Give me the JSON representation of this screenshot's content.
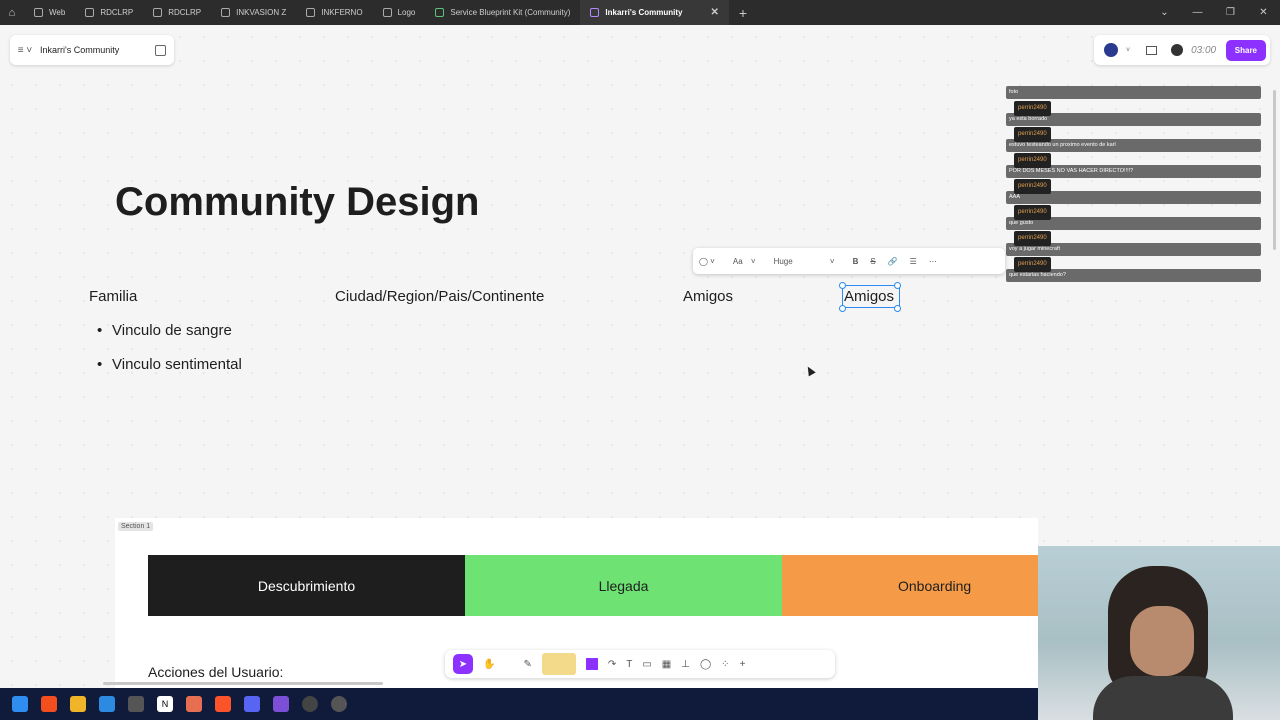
{
  "tabs": [
    {
      "label": "Web"
    },
    {
      "label": "RDCLRP"
    },
    {
      "label": "RDCLRP"
    },
    {
      "label": "INKVASION Z"
    },
    {
      "label": "INKFERNO"
    },
    {
      "label": "Logo"
    },
    {
      "label": "Service Blueprint Kit (Community)"
    },
    {
      "label": "Inkarri's Community"
    }
  ],
  "file": {
    "name": "Inkarri's Community"
  },
  "header": {
    "timer": "03:00",
    "share_label": "Share"
  },
  "canvas": {
    "title": "Community Design",
    "labels": {
      "familia": "Familia",
      "ciudad": "Ciudad/Region/Pais/Continente",
      "amigos": "Amigos",
      "amigos_selected": "Amigos"
    },
    "bullets": [
      "Vinculo de sangre",
      "Vinculo sentimental"
    ]
  },
  "text_toolbar": {
    "font_size": "Huge",
    "aa": "Aa"
  },
  "chat": [
    {
      "name": "",
      "msg": "foto"
    },
    {
      "name": "perrin2490",
      "msg": "ya esta borrado"
    },
    {
      "name": "perrin2490",
      "msg": "estuvo testeando un proximo evento de karl"
    },
    {
      "name": "perrin2490",
      "msg": "POR DOS MESES NO VAS HACER DIRECTO!!!!?"
    },
    {
      "name": "perrin2490",
      "msg": "AAA"
    },
    {
      "name": "perrin2490",
      "msg": "que gusto"
    },
    {
      "name": "perrin2490",
      "msg": "voy a jugar minecraft"
    },
    {
      "name": "perrin2490",
      "msg": "que estarias haciendo?"
    }
  ],
  "section": {
    "label": "Section 1",
    "stages": [
      {
        "label": "Descubrimiento",
        "color": "#1e1e1e",
        "text_color": "#ffffff"
      },
      {
        "label": "Llegada",
        "color": "#6ee273",
        "text_color": "#1e1e1e"
      },
      {
        "label": "Onboarding",
        "color": "#f59b47",
        "text_color": "#1e1e1e"
      }
    ],
    "acciones": "Acciones del Usuario:"
  },
  "colors": {
    "accent": "#8c31ff",
    "selection": "#2b8bf0"
  }
}
